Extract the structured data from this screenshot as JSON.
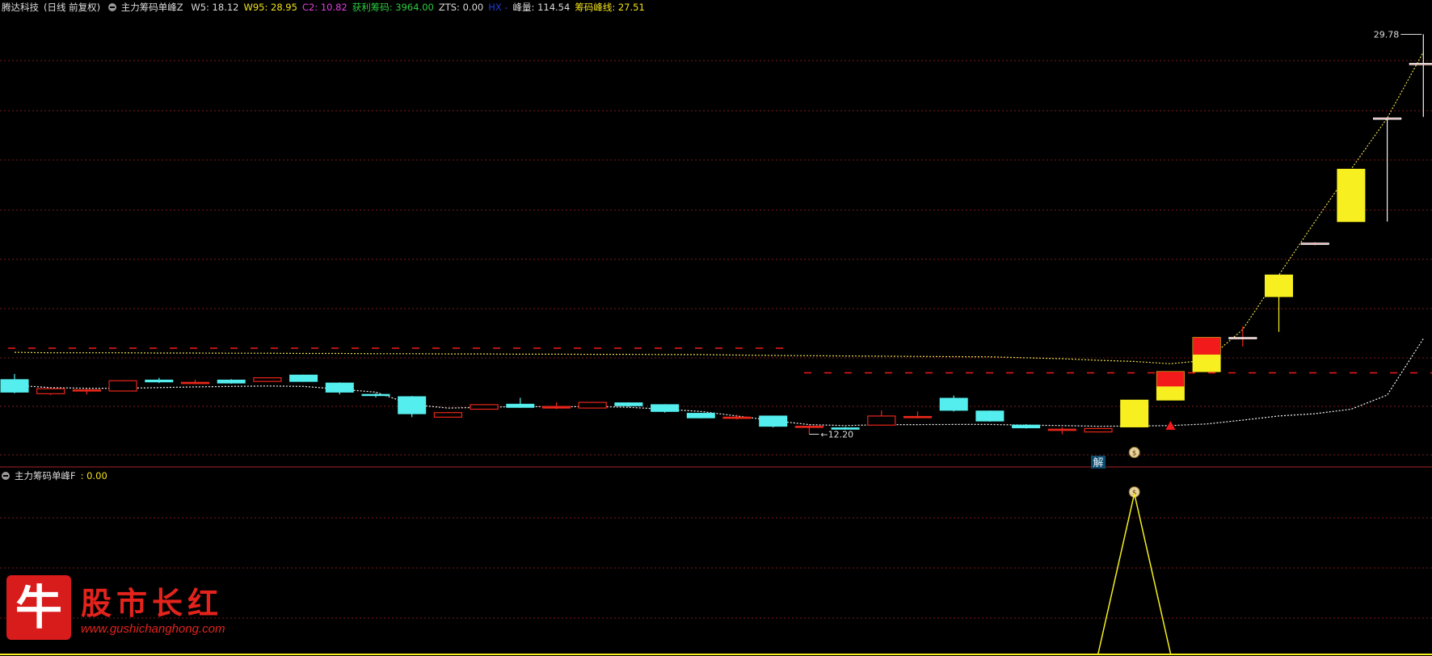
{
  "header": {
    "stock_name": "腾达科技",
    "period": "(日线 前复权)",
    "indicator_name": "主力筹码单峰Z",
    "items": [
      {
        "label": "W5",
        "value": "18.12",
        "color": "#dcdcdc"
      },
      {
        "label": "W95",
        "value": "28.95",
        "color": "#f2e21b"
      },
      {
        "label": "C2",
        "value": "10.82",
        "color": "#e040e0"
      },
      {
        "label": "获利筹码",
        "value": "3964.00",
        "color": "#2ecc40"
      },
      {
        "label": "ZTS",
        "value": "0.00",
        "color": "#dcdcdc"
      },
      {
        "label": "HX",
        "value": "",
        "color": "#1e3cd8"
      },
      {
        "label": "峰量",
        "value": "114.54",
        "color": "#dcdcdc"
      },
      {
        "label": "筹码峰线",
        "value": "27.51",
        "color": "#f2e21b"
      }
    ]
  },
  "sub_header": {
    "indicator_name": "主力筹码单峰F",
    "value": ": 0.00"
  },
  "annotations": {
    "high_label": "29.78",
    "low_label": "12.20",
    "jie_label": "解",
    "moneybag_icon": "moneybag-icon",
    "triangle_icon": "up-triangle-icon"
  },
  "colors": {
    "up": "#e8261a",
    "down": "#55eeee",
    "signal_yellow": "#f7ef1f",
    "signal_red": "#f21a1a",
    "grid": "#7a1c1c",
    "avg_line": "#f0e68c"
  },
  "chart_data": {
    "type": "candlestick",
    "x": [
      1,
      2,
      3,
      4,
      5,
      6,
      7,
      8,
      9,
      10,
      11,
      12,
      13,
      14,
      15,
      16,
      17,
      18,
      19,
      20,
      21,
      22,
      23,
      24,
      25,
      26,
      27,
      28,
      29,
      30,
      31,
      32,
      33,
      34,
      35,
      36,
      37,
      38,
      39,
      40
    ],
    "candles": [
      {
        "o": 14.6,
        "c": 14.05,
        "h": 14.85,
        "l": 14.0,
        "dir": "down"
      },
      {
        "o": 13.98,
        "c": 14.2,
        "h": 14.22,
        "l": 13.92,
        "dir": "up"
      },
      {
        "o": 14.1,
        "c": 14.15,
        "h": 14.2,
        "l": 13.95,
        "dir": "up"
      },
      {
        "o": 14.1,
        "c": 14.55,
        "h": 14.58,
        "l": 14.08,
        "dir": "up"
      },
      {
        "o": 14.58,
        "c": 14.5,
        "h": 14.68,
        "l": 14.45,
        "dir": "down"
      },
      {
        "o": 14.45,
        "c": 14.48,
        "h": 14.6,
        "l": 14.4,
        "dir": "up"
      },
      {
        "o": 14.58,
        "c": 14.45,
        "h": 14.62,
        "l": 14.42,
        "dir": "down"
      },
      {
        "o": 14.52,
        "c": 14.68,
        "h": 14.7,
        "l": 14.5,
        "dir": "up"
      },
      {
        "o": 14.8,
        "c": 14.52,
        "h": 14.82,
        "l": 14.5,
        "dir": "down"
      },
      {
        "o": 14.45,
        "c": 14.05,
        "h": 14.48,
        "l": 13.95,
        "dir": "down"
      },
      {
        "o": 13.95,
        "c": 13.9,
        "h": 14.0,
        "l": 13.82,
        "dir": "down"
      },
      {
        "o": 13.85,
        "c": 13.1,
        "h": 13.88,
        "l": 12.95,
        "dir": "down"
      },
      {
        "o": 12.95,
        "c": 13.15,
        "h": 13.18,
        "l": 12.92,
        "dir": "up"
      },
      {
        "o": 13.3,
        "c": 13.5,
        "h": 13.52,
        "l": 13.28,
        "dir": "up"
      },
      {
        "o": 13.52,
        "c": 13.38,
        "h": 13.8,
        "l": 13.36,
        "dir": "down"
      },
      {
        "o": 13.35,
        "c": 13.42,
        "h": 13.6,
        "l": 13.3,
        "dir": "up"
      },
      {
        "o": 13.35,
        "c": 13.6,
        "h": 13.62,
        "l": 13.33,
        "dir": "up"
      },
      {
        "o": 13.58,
        "c": 13.45,
        "h": 13.6,
        "l": 13.4,
        "dir": "down"
      },
      {
        "o": 13.5,
        "c": 13.2,
        "h": 13.52,
        "l": 13.15,
        "dir": "down"
      },
      {
        "o": 13.12,
        "c": 12.92,
        "h": 13.14,
        "l": 12.9,
        "dir": "down"
      },
      {
        "o": 12.92,
        "c": 12.95,
        "h": 13.05,
        "l": 12.85,
        "dir": "up"
      },
      {
        "o": 13.0,
        "c": 12.55,
        "h": 13.02,
        "l": 12.5,
        "dir": "down"
      },
      {
        "o": 12.5,
        "c": 12.55,
        "h": 12.6,
        "l": 12.2,
        "dir": "up"
      },
      {
        "o": 12.48,
        "c": 12.42,
        "h": 12.52,
        "l": 12.4,
        "dir": "down"
      },
      {
        "o": 12.6,
        "c": 13.0,
        "h": 13.25,
        "l": 12.58,
        "dir": "up"
      },
      {
        "o": 12.95,
        "c": 12.98,
        "h": 13.2,
        "l": 12.9,
        "dir": "up"
      },
      {
        "o": 13.78,
        "c": 13.25,
        "h": 13.9,
        "l": 13.2,
        "dir": "down"
      },
      {
        "o": 13.22,
        "c": 12.78,
        "h": 13.24,
        "l": 12.75,
        "dir": "down"
      },
      {
        "o": 12.6,
        "c": 12.48,
        "h": 12.64,
        "l": 12.45,
        "dir": "down"
      },
      {
        "o": 12.4,
        "c": 12.42,
        "h": 12.5,
        "l": 12.2,
        "dir": "up"
      },
      {
        "o": 12.3,
        "c": 12.45,
        "h": 12.48,
        "l": 12.28,
        "dir": "up"
      },
      {
        "o": 12.52,
        "c": 13.7,
        "h": 13.7,
        "l": 12.52,
        "dir": "signal"
      },
      {
        "o": 13.7,
        "c": 14.95,
        "h": 14.95,
        "l": 13.7,
        "dir": "signal"
      },
      {
        "o": 14.95,
        "c": 16.45,
        "h": 16.45,
        "l": 14.95,
        "dir": "signal"
      },
      {
        "o": 16.4,
        "c": 16.45,
        "h": 16.95,
        "l": 16.05,
        "dir": "up"
      },
      {
        "o": 19.2,
        "c": 18.25,
        "h": 19.2,
        "l": 16.7,
        "dir": "signal"
      },
      {
        "o": 20.55,
        "c": 20.6,
        "h": 20.65,
        "l": 20.5,
        "dir": "up"
      },
      {
        "o": 21.55,
        "c": 23.85,
        "h": 23.85,
        "l": 21.55,
        "dir": "signal"
      },
      {
        "o": 26.05,
        "c": 26.1,
        "h": 26.1,
        "l": 21.55,
        "dir": "up"
      },
      {
        "o": 28.45,
        "c": 28.5,
        "h": 29.78,
        "l": 26.15,
        "dir": "up"
      }
    ],
    "avg_line": [
      14.35,
      14.25,
      14.22,
      14.22,
      14.25,
      14.28,
      14.3,
      14.32,
      14.3,
      14.18,
      14.05,
      13.5,
      13.35,
      13.38,
      13.42,
      13.4,
      13.42,
      13.38,
      13.3,
      13.2,
      13.0,
      12.8,
      12.62,
      12.58,
      12.62,
      12.62,
      12.63,
      12.63,
      12.6,
      12.58,
      12.55,
      12.56,
      12.58,
      12.65,
      12.82,
      13.0,
      13.1,
      13.3,
      13.92,
      16.4
    ],
    "peak_line": [
      15.8,
      15.78,
      15.78,
      15.78,
      15.77,
      15.77,
      15.76,
      15.76,
      15.75,
      15.75,
      15.74,
      15.74,
      15.73,
      15.73,
      15.72,
      15.72,
      15.71,
      15.71,
      15.7,
      15.7,
      15.68,
      15.66,
      15.65,
      15.64,
      15.63,
      15.62,
      15.61,
      15.6,
      15.56,
      15.52,
      15.45,
      15.4,
      15.3,
      15.45,
      16.8,
      19.2,
      21.55,
      23.85,
      26.1,
      29.0
    ],
    "ref_high": 15.98,
    "ref_mid": 14.9,
    "sub_signal_bar": 32,
    "ylim": [
      11.4,
      30.4
    ]
  }
}
